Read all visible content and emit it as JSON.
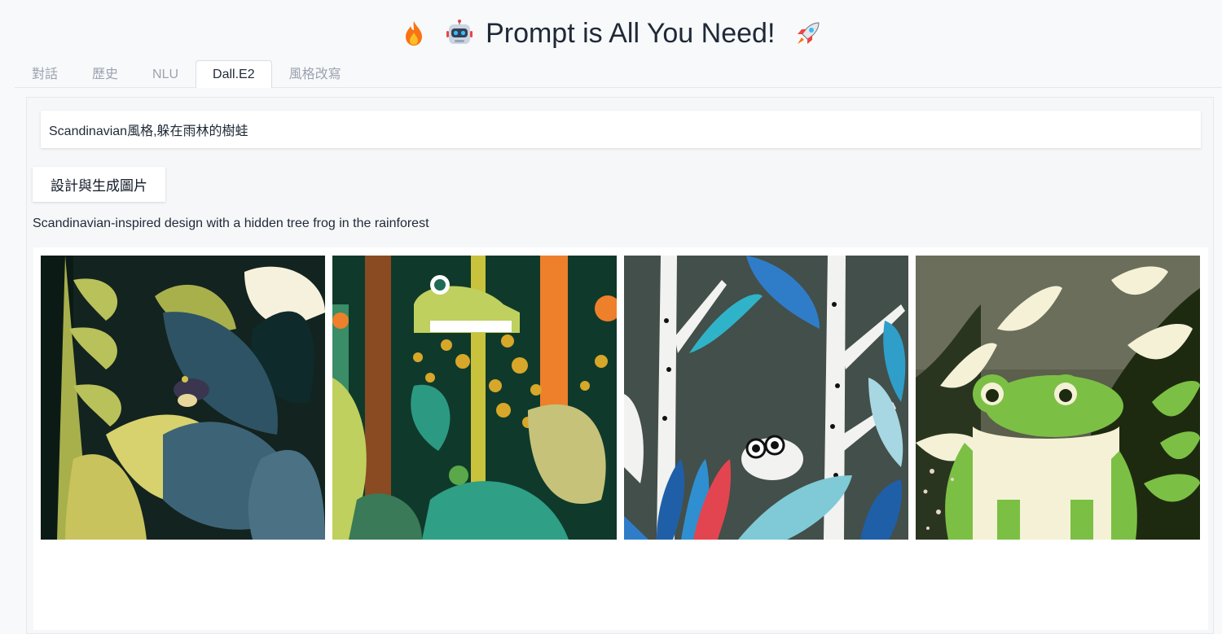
{
  "header": {
    "title": "Prompt is All You Need!",
    "emoji_left": [
      "fire-icon",
      "robot-icon"
    ],
    "emoji_right": "rocket-icon"
  },
  "tabs": [
    {
      "label": "對話",
      "active": false
    },
    {
      "label": "歷史",
      "active": false
    },
    {
      "label": "NLU",
      "active": false
    },
    {
      "label": "Dall.E2",
      "active": true
    },
    {
      "label": "風格改寫",
      "active": false
    }
  ],
  "prompt": {
    "value": "Scandinavian風格,躲在雨林的樹蛙"
  },
  "generate_button": {
    "label": "設計與生成圖片"
  },
  "result": {
    "description": "Scandinavian-inspired design with a hidden tree frog in the rainforest"
  },
  "gallery": {
    "images": [
      {
        "name": "rainforest-frog-image-1"
      },
      {
        "name": "rainforest-frog-image-2"
      },
      {
        "name": "rainforest-frog-image-3"
      },
      {
        "name": "rainforest-frog-image-4"
      }
    ]
  },
  "colors": {
    "background": "#f8f9fb",
    "text": "#1f2937",
    "tab_inactive": "#9ca3af"
  }
}
